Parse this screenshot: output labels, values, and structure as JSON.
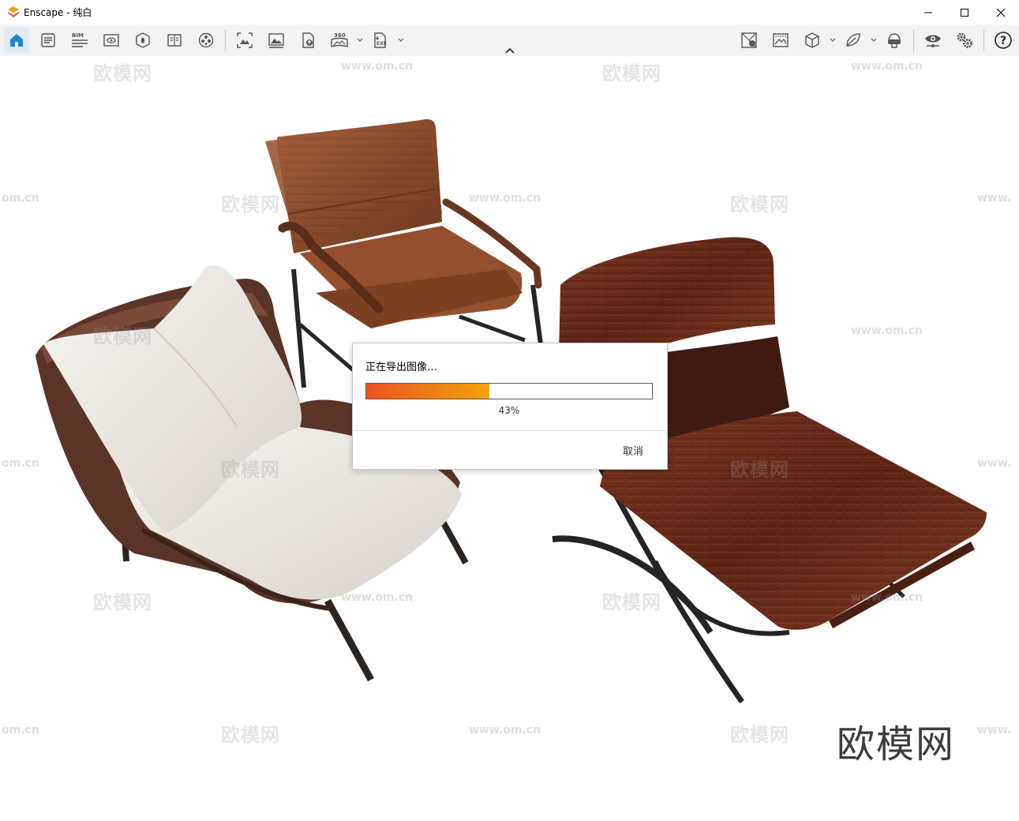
{
  "window": {
    "app_name": "Enscape",
    "title_separator": " - ",
    "document_name": "纯白",
    "controls": [
      "minimize-icon",
      "maximize-icon",
      "close-icon"
    ]
  },
  "toolbar": {
    "left_tools": [
      {
        "name": "home-icon",
        "active": true
      },
      {
        "name": "asset-library-icon"
      },
      {
        "name": "bim-icon",
        "label": "BIM"
      },
      {
        "name": "view-management-icon"
      },
      {
        "name": "material-editor-icon"
      },
      {
        "name": "book-icon"
      },
      {
        "name": "video-editor-icon"
      }
    ],
    "render_tools": [
      {
        "name": "screenshot-icon"
      },
      {
        "name": "batch-render-icon"
      },
      {
        "name": "upload-icon"
      },
      {
        "name": "panorama-icon",
        "label": "360",
        "has_dropdown": true
      },
      {
        "name": "export-exe-icon",
        "label": "EXE",
        "has_dropdown": true
      }
    ],
    "right_tools": [
      {
        "name": "vr-icon"
      },
      {
        "name": "image-settings-icon"
      },
      {
        "name": "cube-icon",
        "has_dropdown": true
      },
      {
        "name": "atmosphere-icon",
        "has_dropdown": true
      },
      {
        "name": "headset-icon"
      }
    ],
    "settings_tools": [
      {
        "name": "eye-icon"
      },
      {
        "name": "settings-icon"
      }
    ],
    "help": {
      "name": "help-icon",
      "label": "?"
    }
  },
  "watermark": {
    "brand": "欧模网",
    "url": "www.om.cn",
    "url_short": "om.cn",
    "url_prefix": "www.",
    "corner_brand": "欧模网"
  },
  "export_dialog": {
    "title": "正在导出图像…",
    "progress_percent": 43,
    "progress_label": "43%",
    "cancel_label": "取消",
    "accent_start": "#ee5120",
    "accent_end": "#f3a30a"
  },
  "scene": {
    "objects": [
      "white-cushion-lounge-chair",
      "brown-leather-armchair",
      "textured-leather-lounge-chair"
    ],
    "colors": {
      "white_cushion": "#ede8e3",
      "chair_frame": "#5a3427",
      "brown_leather": "#8e4a2a",
      "dark_leather": "#6d2d1a",
      "metal": "#262626"
    }
  }
}
